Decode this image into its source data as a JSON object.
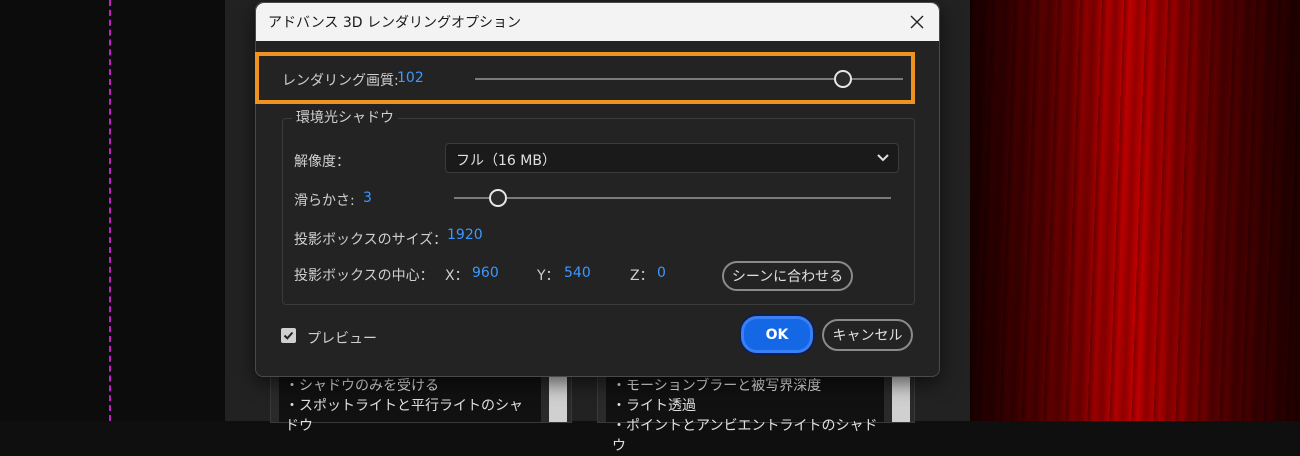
{
  "dialog": {
    "title": "アドバンス 3D レンダリングオプション",
    "render_quality": {
      "label": "レンダリング画質:",
      "value": "102",
      "slider_fraction": 0.86
    },
    "ambient_shadow": {
      "group_title": "環境光シャドウ",
      "resolution": {
        "label": "解像度：",
        "selected": "フル（16 MB）"
      },
      "smoothness": {
        "label": "滑らかさ:",
        "value": "3",
        "slider_fraction": 0.1
      },
      "projection_box_size": {
        "label": "投影ボックスのサイズ：",
        "value": "1920"
      },
      "projection_box_center": {
        "label": "投影ボックスの中心：",
        "x_label": "X：",
        "x_value": "960",
        "y_label": "Y：",
        "y_value": "540",
        "z_label": "Z：",
        "z_value": "0"
      },
      "fit_scene_button": "シーンに合わせる"
    },
    "preview": {
      "label": "プレビュー",
      "checked": true
    },
    "ok_button": "OK",
    "cancel_button": "キャンセル"
  },
  "background": {
    "left_card_lines": [
      "・シャドウのみを受ける",
      "・スポットライトと平行ライトのシャドウ"
    ],
    "right_card_lines": [
      "・モーションブラーと被写界深度",
      "・ライト透過",
      "・ポイントとアンビエントライトのシャドウ"
    ]
  },
  "colors": {
    "accent": "#3d98ff",
    "highlight": "#f0921f",
    "ok": "#1468e6"
  },
  "icons": {
    "close": "close-icon",
    "chevron": "chevron-down-icon",
    "check": "check-icon"
  }
}
